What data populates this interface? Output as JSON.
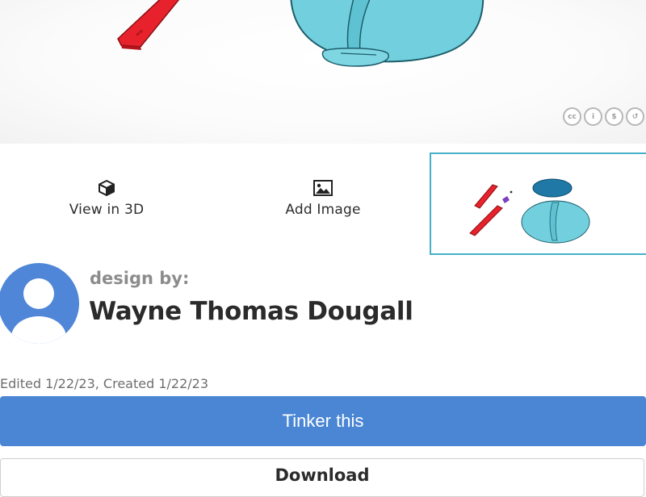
{
  "viewer": {
    "license_icons": [
      {
        "name": "cc-icon",
        "glyph": "cc"
      },
      {
        "name": "attribution-icon",
        "glyph": "i"
      },
      {
        "name": "noncommercial-icon",
        "glyph": "$"
      },
      {
        "name": "sharealike-icon",
        "glyph": "↺"
      }
    ]
  },
  "actions": {
    "view_3d_label": "View in 3D",
    "add_image_label": "Add Image"
  },
  "designer": {
    "design_by_label": "design by:",
    "name": "Wayne Thomas Dougall"
  },
  "dates": "Edited 1/22/23, Created 1/22/23",
  "buttons": {
    "tinker_label": "Tinker this",
    "download_label": "Download"
  },
  "colors": {
    "accent_blue": "#4a86d4",
    "thumbnail_border": "#46b0c8",
    "model_red": "#e8222c",
    "model_cyan": "#72d0de",
    "model_dark_blue": "#1f78a6",
    "model_purple": "#7b3fbf"
  }
}
